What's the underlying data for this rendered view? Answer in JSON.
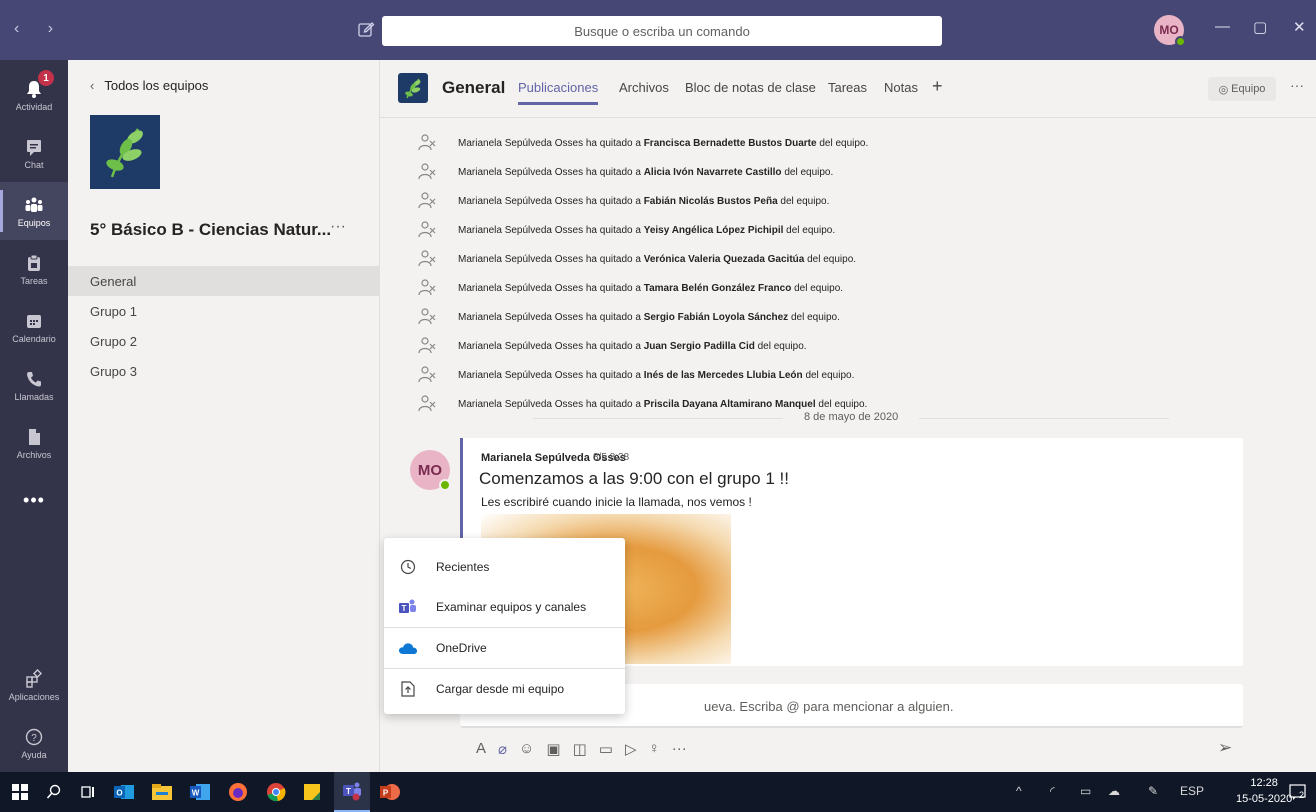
{
  "titlebar": {
    "search_placeholder": "Busque o escriba un comando",
    "avatar_initials": "MO",
    "nav_arrows": "‹ ›"
  },
  "rail": {
    "items": [
      {
        "label": "Actividad",
        "icon": "bell-icon",
        "badge": "1"
      },
      {
        "label": "Chat",
        "icon": "chat-icon"
      },
      {
        "label": "Equipos",
        "icon": "teams-icon"
      },
      {
        "label": "Tareas",
        "icon": "assignments-icon"
      },
      {
        "label": "Calendario",
        "icon": "calendar-icon"
      },
      {
        "label": "Llamadas",
        "icon": "phone-icon"
      },
      {
        "label": "Archivos",
        "icon": "file-icon"
      }
    ],
    "more": "•••",
    "apps_label": "Aplicaciones",
    "help_label": "Ayuda"
  },
  "team_panel": {
    "back_label": "Todos los equipos",
    "team_name": "5° Básico B - Ciencias Natur...",
    "more": "···",
    "channels": [
      "General",
      "Grupo 1",
      "Grupo 2",
      "Grupo 3"
    ]
  },
  "header": {
    "title": "General",
    "tabs": [
      "Publicaciones",
      "Archivos",
      "Bloc de notas de clase",
      "Tareas",
      "Notas"
    ],
    "add_tab": "+",
    "team_button": "Equipo",
    "more": "···"
  },
  "activity": {
    "actor": "Marianela Sepúlveda Osses",
    "verb": "ha quitado a",
    "suffix": "del equipo.",
    "removed": [
      "Francisca Bernadette Bustos Duarte",
      "Alicia Ivón Navarrete Castillo",
      "Fabián Nicolás Bustos Peña",
      "Yeisy Angélica López Pichipil",
      "Verónica Valeria Quezada Gacitúa",
      "Tamara Belén González Franco",
      "Sergio Fabián Loyola Sánchez",
      "Juan Sergio Padilla Cid",
      "Inés de las Mercedes Llubia León",
      "Priscila Dayana Altamirano Manquel"
    ]
  },
  "date_separator": "8 de mayo de 2020",
  "post": {
    "avatar": "MO",
    "author": "Marianela Sepúlveda Osses",
    "time": "8/5 8:28",
    "subject": "Comenzamos a las 9:00 con el grupo 1 !!",
    "body": "Les escribiré cuando inicie la llamada, nos vemos !"
  },
  "compose": {
    "placeholder": "ueva. Escriba @ para mencionar a alguien."
  },
  "attach_menu": {
    "items": [
      {
        "label": "Recientes",
        "icon": "clock-icon"
      },
      {
        "label": "Examinar equipos y canales",
        "icon": "teams-icon"
      },
      {
        "label": "OneDrive",
        "icon": "cloud-icon"
      },
      {
        "label": "Cargar desde mi equipo",
        "icon": "upload-icon"
      }
    ]
  },
  "taskbar": {
    "lang": "ESP",
    "time": "12:28",
    "date": "15-05-2020",
    "notif_count": "2"
  },
  "colors": {
    "accent": "#6264a7",
    "titlebar": "#464775",
    "rail": "#33344a",
    "online": "#6bb700",
    "badge": "#c4314b"
  }
}
